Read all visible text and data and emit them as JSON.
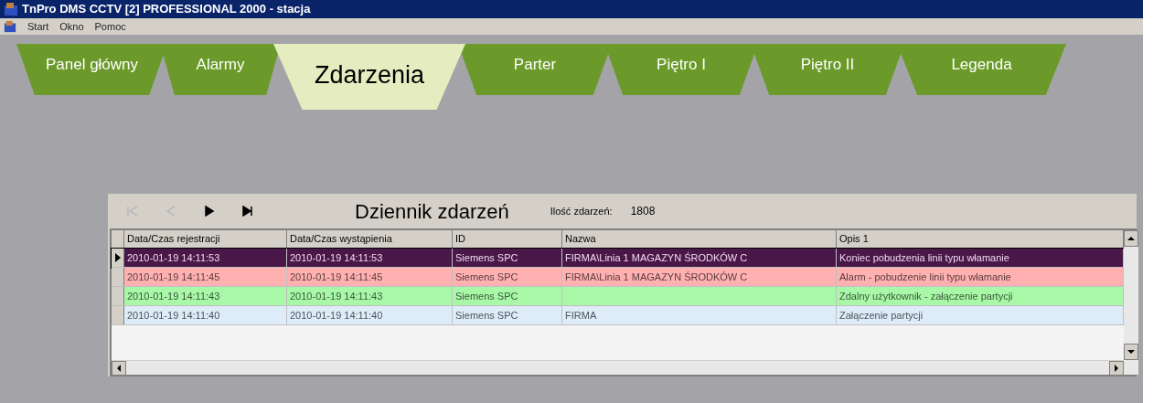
{
  "window": {
    "title": "TnPro DMS CCTV [2] PROFESSIONAL 2000 - stacja"
  },
  "menu": [
    "Start",
    "Okno",
    "Pomoc"
  ],
  "tabs": [
    {
      "label": "Panel główny",
      "selected": false
    },
    {
      "label": "Alarmy",
      "selected": false
    },
    {
      "label": "Zdarzenia",
      "selected": true
    },
    {
      "label": "Parter",
      "selected": false
    },
    {
      "label": "Piętro I",
      "selected": false
    },
    {
      "label": "Piętro II",
      "selected": false
    },
    {
      "label": "Legenda",
      "selected": false
    }
  ],
  "log": {
    "nav_buttons": [
      {
        "kind": "first",
        "disabled": true
      },
      {
        "kind": "prev",
        "disabled": true
      },
      {
        "kind": "next",
        "disabled": false
      },
      {
        "kind": "last",
        "disabled": false
      }
    ],
    "title": "Dziennik zdarzeń",
    "count_label": "Ilość zdarzeń:",
    "count": "1808",
    "table": {
      "columns": [
        "Data/Czas rejestracji",
        "Data/Czas wystąpienia",
        "ID",
        "Nazwa",
        "Opis 1"
      ],
      "rows": [
        {
          "cells": [
            "2010-01-19 14:11:53",
            "2010-01-19 14:11:53",
            "Siemens SPC",
            "FIRMA\\Linia 1 MAGAZYN ŚRODKÓW C",
            "Koniec pobudzenia linii typu włamanie"
          ],
          "color": "#4a1848",
          "selected": true
        },
        {
          "cells": [
            "2010-01-19 14:11:45",
            "2010-01-19 14:11:45",
            "Siemens SPC",
            "FIRMA\\Linia 1 MAGAZYN ŚRODKÓW C",
            "Alarm - pobudzenie linii typu włamanie"
          ],
          "color": "#ffb0b0",
          "selected": false
        },
        {
          "cells": [
            "2010-01-19 14:11:43",
            "2010-01-19 14:11:43",
            "Siemens SPC",
            "",
            "Zdalny użytkownik - załączenie partycji"
          ],
          "color": "#a8f8a8",
          "selected": false
        },
        {
          "cells": [
            "2010-01-19 14:11:40",
            "2010-01-19 14:11:40",
            "Siemens SPC",
            "FIRMA",
            "Załączenie partycji"
          ],
          "color": "#deecfa",
          "selected": false
        }
      ]
    }
  }
}
